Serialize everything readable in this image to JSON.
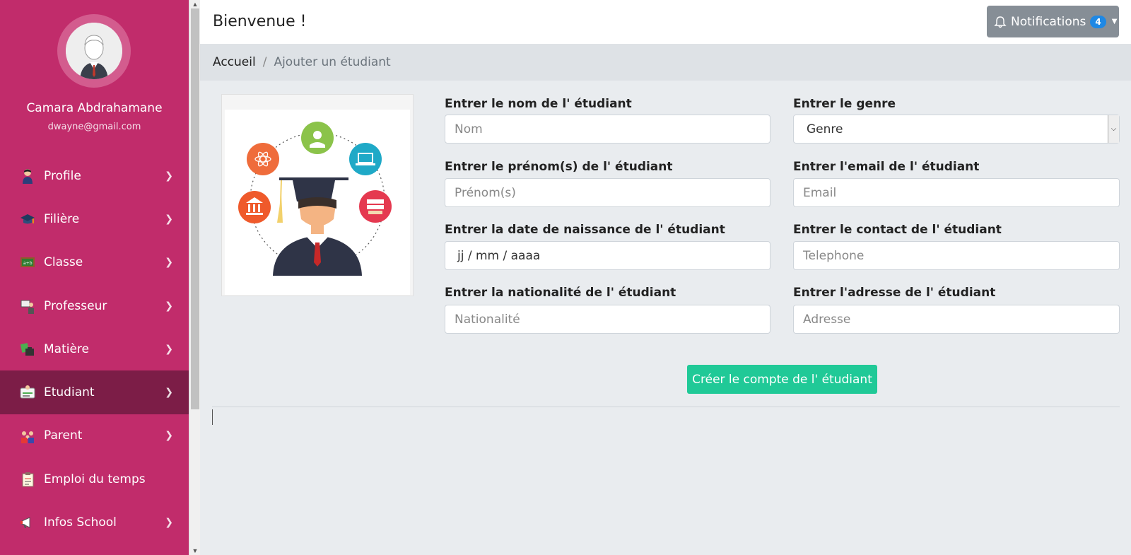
{
  "sidebar": {
    "user_name": "Camara Abdrahamane",
    "user_email": "dwayne@gmail.com",
    "items": [
      {
        "label": "Profile",
        "icon": "person-icon",
        "has_chevron": true
      },
      {
        "label": "Filière",
        "icon": "graduation-cap-icon",
        "has_chevron": true
      },
      {
        "label": "Classe",
        "icon": "blackboard-icon",
        "has_chevron": true
      },
      {
        "label": "Professeur",
        "icon": "teacher-icon",
        "has_chevron": true
      },
      {
        "label": "Matière",
        "icon": "books-icon",
        "has_chevron": true
      },
      {
        "label": "Etudiant",
        "icon": "id-card-icon",
        "has_chevron": true,
        "active": true
      },
      {
        "label": "Parent",
        "icon": "family-icon",
        "has_chevron": true
      },
      {
        "label": "Emploi du temps",
        "icon": "schedule-icon",
        "has_chevron": false
      },
      {
        "label": "Infos School",
        "icon": "megaphone-icon",
        "has_chevron": true
      }
    ],
    "colors": {
      "background": "#c12c6b",
      "active": "#7c1d47"
    }
  },
  "topbar": {
    "title": "Bienvenue !",
    "notifications_label": "Notifications",
    "notifications_count": "4"
  },
  "breadcrumb": {
    "home": "Accueil",
    "separator": "/",
    "current": "Ajouter un étudiant"
  },
  "form": {
    "nom": {
      "label": "Entrer le nom de l' étudiant",
      "placeholder": "Nom"
    },
    "genre": {
      "label": "Entrer le genre",
      "value": "Genre"
    },
    "prenom": {
      "label": "Entrer le prénom(s) de l' étudiant",
      "placeholder": "Prénom(s)"
    },
    "email": {
      "label": "Entrer l'email de l' étudiant",
      "placeholder": "Email"
    },
    "date": {
      "label": "Entrer la date de naissance de l' étudiant",
      "value": "jj / mm / aaaa"
    },
    "contact": {
      "label": "Entrer le contact de l' étudiant",
      "placeholder": "Telephone"
    },
    "nationalite": {
      "label": "Entrer la nationalité de l' étudiant",
      "placeholder": "Nationalité"
    },
    "adresse": {
      "label": "Entrer l'adresse de l' étudiant",
      "placeholder": "Adresse"
    },
    "submit_label": "Créer le compte de l' étudiant",
    "submit_color": "#20c997"
  }
}
